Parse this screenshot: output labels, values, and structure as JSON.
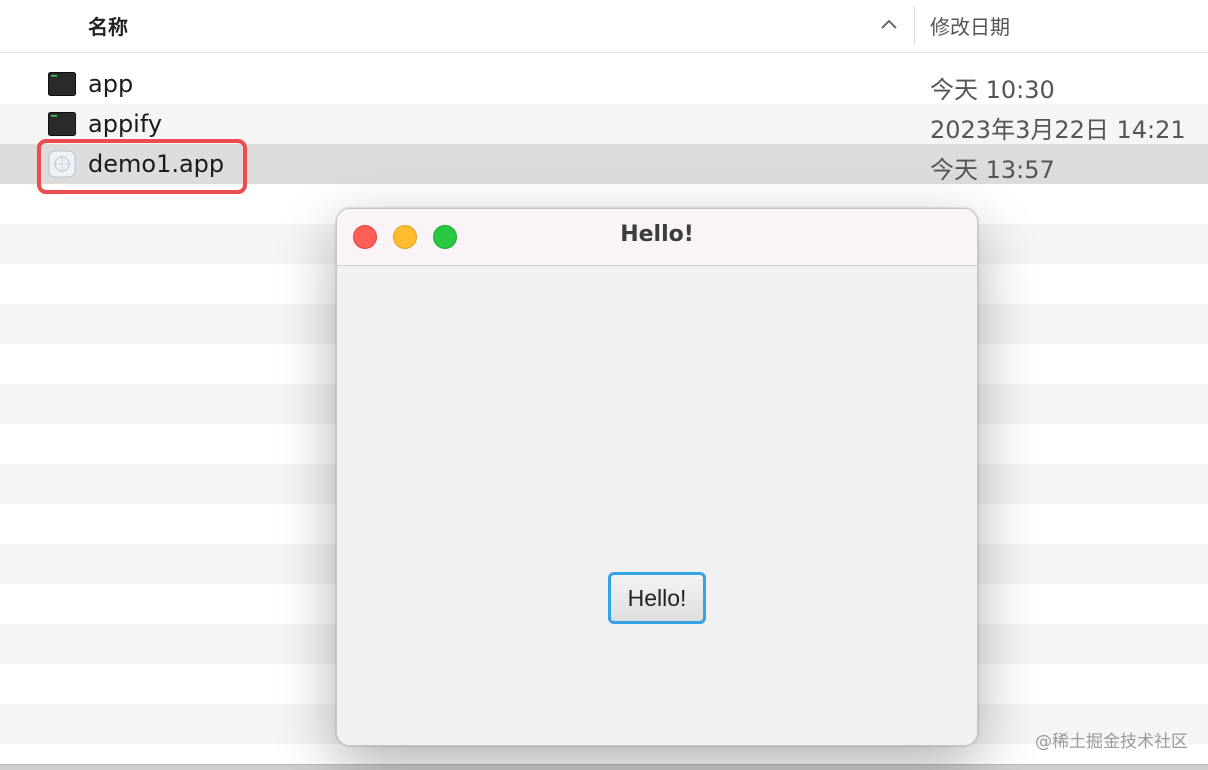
{
  "finder": {
    "column_headers": {
      "name": "名称",
      "date_modified": "修改日期"
    },
    "sort_icon": "chevron-up-icon",
    "files": [
      {
        "name": "app",
        "date": "今天 10:30",
        "icon": "terminal-exec-icon"
      },
      {
        "name": "appify",
        "date": "2023年3月22日 14:21",
        "icon": "terminal-exec-icon"
      },
      {
        "name": "demo1.app",
        "date": "今天 13:57",
        "icon": "generic-app-icon",
        "selected": true
      }
    ],
    "highlight_color": "#ec4c4f"
  },
  "app_window": {
    "title": "Hello!",
    "button_label": "Hello!",
    "traffic_lights": {
      "close": "#fe5f57",
      "minimize": "#febc2e",
      "maximize": "#28c840"
    },
    "button_focus_color": "#35a4e6"
  },
  "watermark": "@稀土掘金技术社区"
}
